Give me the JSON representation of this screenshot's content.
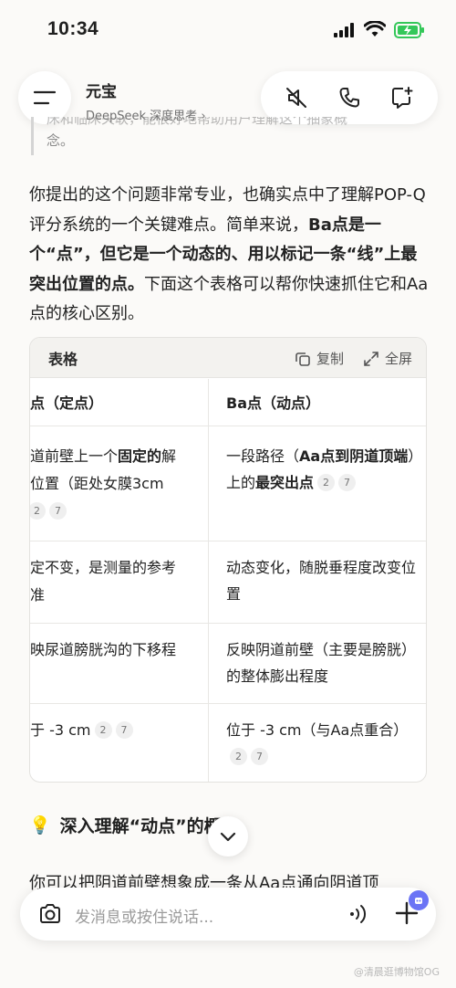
{
  "status_bar": {
    "time": "10:34"
  },
  "header": {
    "title": "元宝",
    "subtitle": "DeepSeek 深度思考",
    "subtitle_chevron": "›"
  },
  "quote": {
    "line1": "床和临床关联，能很好地帮助用户理解这个抽象概",
    "line2": "念。"
  },
  "paragraph": {
    "p1": "你提出的这个问题非常专业，也确实点中了理解POP-Q评分系统的一个关键难点。简单来说，",
    "p_bold1": "Ba点是一个“点”，但它是一个动态的、用以标记一条“线”上最突出位置的点。",
    "p2": "下面这个表格可以帮你快速抓住它和Aa点的核心区别。"
  },
  "table": {
    "label": "表格",
    "copy_label": "复制",
    "fullscreen_label": "全屏",
    "headers": [
      "点（定点）",
      "Ba点（动点）"
    ],
    "rows": [
      {
        "c1_l1": "道前壁上一个",
        "c1_l1b": "固定的",
        "c1_l1c": "解",
        "c1_l2": "位置（距处女膜3cm",
        "c1_refs": [
          "2",
          "7"
        ],
        "c2_pre": "一段路径（",
        "c2_bold": "Aa点到阴道顶端",
        "c2_mid": "）上的",
        "c2_bold2": "最突出点",
        "c2_refs": [
          "2",
          "7"
        ]
      },
      {
        "c1_l1": "定不变，是测量的参考",
        "c1_l2": "准",
        "c2": "动态变化，随脱垂程度改变位置"
      },
      {
        "c1_l1": "映尿道膀胱沟的下移程",
        "c2": "反映阴道前壁（主要是膀胱）的整体膨出程度"
      },
      {
        "c1_l1": "于 -3 cm",
        "c1_refs": [
          "2",
          "7"
        ],
        "c2": "位于 -3 cm（与Aa点重合）",
        "c2_refs": [
          "2",
          "7"
        ]
      }
    ]
  },
  "section": {
    "emoji": "💡",
    "heading": "深入理解“动点”的概念"
  },
  "partial_text": "你可以把阴道前壁想象成一条从Aa点通向阴道顶",
  "input": {
    "placeholder": "发消息或按住说话..."
  },
  "watermark": "@清晨逛博物馆OG",
  "icons": {
    "menu": "menu-icon",
    "mute": "speaker-mute-icon",
    "phone": "phone-icon",
    "new_chat": "new-chat-icon",
    "copy": "copy-icon",
    "fullscreen": "expand-icon",
    "camera": "camera-icon",
    "voice": "voice-wave-icon",
    "plus": "plus-icon",
    "scroll": "chevron-down-icon"
  }
}
